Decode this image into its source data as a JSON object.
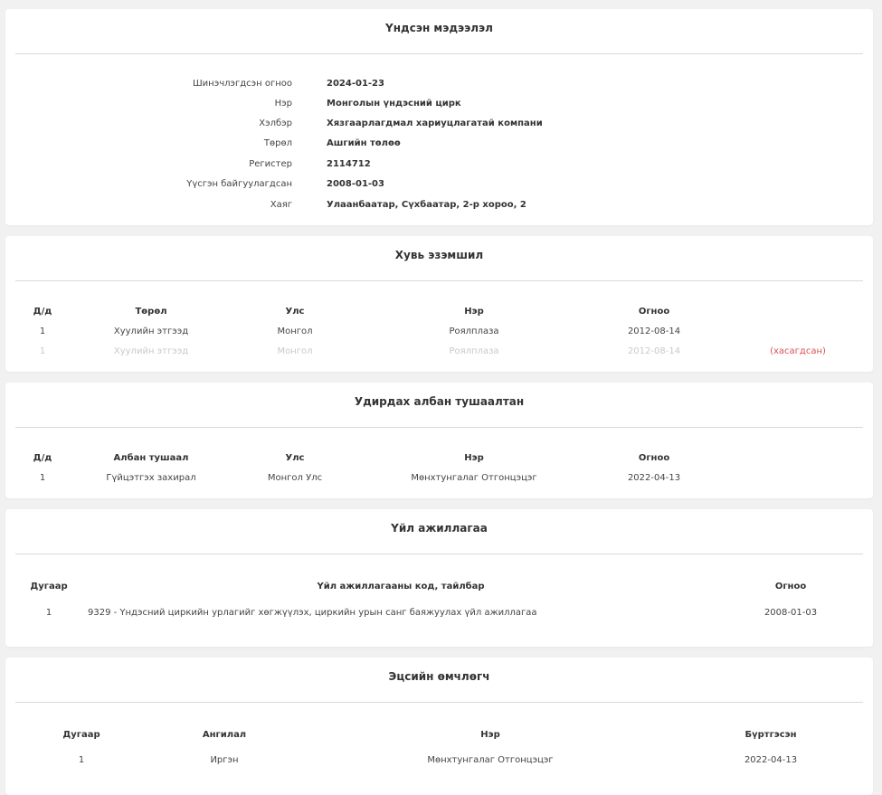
{
  "basic_info": {
    "title": "Үндсэн мэдээлэл",
    "fields": [
      {
        "label": "Шинэчлэгдсэн огноо",
        "value": "2024-01-23"
      },
      {
        "label": "Нэр",
        "value": "Монголын үндэсний цирк"
      },
      {
        "label": "Хэлбэр",
        "value": "Хязгаарлагдмал хариуцлагатай компани"
      },
      {
        "label": "Төрөл",
        "value": "Ашгийн төлөө"
      },
      {
        "label": "Регистер",
        "value": "2114712"
      },
      {
        "label": "Үүсгэн байгуулагдсан",
        "value": "2008-01-03"
      },
      {
        "label": "Хаяг",
        "value": "Улаанбаатар, Сүхбаатар, 2-р хороо, 2"
      }
    ]
  },
  "ownership": {
    "title": "Хувь эзэмшил",
    "headers": [
      "Д/д",
      "Төрөл",
      "Улс",
      "Нэр",
      "Огноо"
    ],
    "rows": [
      {
        "no": "1",
        "type": "Хуулийн этгээд",
        "country": "Монгол",
        "name": "Роялплаза",
        "date": "2012-08-14",
        "status": ""
      },
      {
        "no": "1",
        "type": "Хуулийн этгээд",
        "country": "Монгол",
        "name": "Роялплаза",
        "date": "2012-08-14",
        "status": "(хасагдсан)"
      }
    ]
  },
  "officials": {
    "title": "Удирдах албан тушаалтан",
    "headers": [
      "Д/д",
      "Албан тушаал",
      "Улс",
      "Нэр",
      "Огноо"
    ],
    "rows": [
      {
        "no": "1",
        "position": "Гүйцэтгэх захирал",
        "country": "Монгол Улс",
        "name": "Мөнхтунгалаг Отгонцэцэг",
        "date": "2022-04-13"
      }
    ]
  },
  "activity": {
    "title": "Үйл ажиллагаа",
    "headers": [
      "Дугаар",
      "Үйл ажиллагааны код, тайлбар",
      "Огноо"
    ],
    "rows": [
      {
        "no": "1",
        "description": "9329 - Үндэсний циркийн урлагийг хөгжүүлэх, циркийн урын санг баяжуулах үйл ажиллагаа",
        "date": "2008-01-03"
      }
    ]
  },
  "beneficial_owner": {
    "title": "Эцсийн өмчлөгч",
    "headers": [
      "Дугаар",
      "Ангилал",
      "Нэр",
      "Бүртгэсэн"
    ],
    "rows": [
      {
        "no": "1",
        "category": "Иргэн",
        "name": "Мөнхтунгалаг Отгонцэцэг",
        "registered": "2022-04-13"
      }
    ]
  },
  "colors": {
    "background": "#f1f1f1",
    "card": "#ffffff",
    "removed": "#d9534f",
    "faded": "#c9c9c9"
  }
}
